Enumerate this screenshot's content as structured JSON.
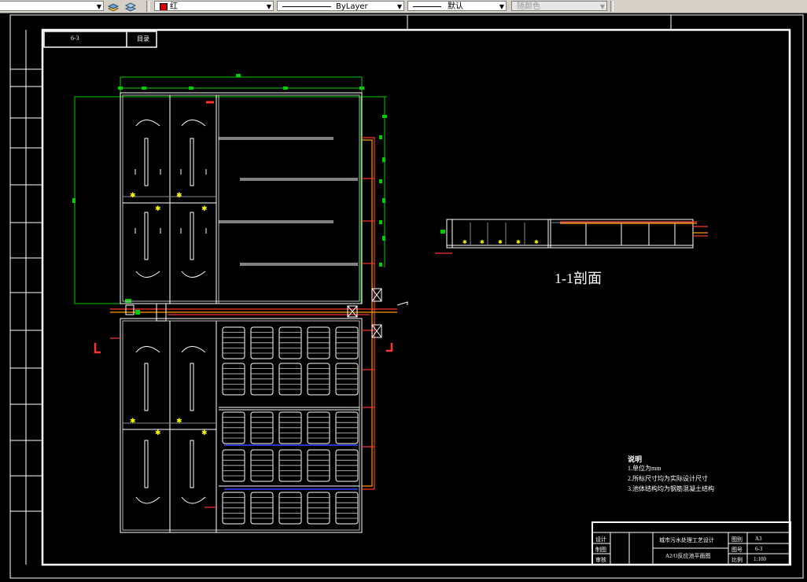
{
  "toolbar": {
    "layer_dropdown_value": "",
    "color_label": "红",
    "color_swatch": "#cc0000",
    "linetype_value": "ByLayer",
    "lineweight_value": "默认",
    "plotstyle_value": "随颜色"
  },
  "drawing": {
    "header_number": "6-3",
    "header_name": "目录",
    "section_title": "1-1剖面",
    "notes_title": "说明",
    "notes": [
      "1.单位为mm",
      "2.所标尺寸均为实际设计尺寸",
      "3.池体结构均为钢筋混凝土结构"
    ],
    "title_block": {
      "project": "城市污水处理工艺设计",
      "drawing_name": "A2/O反应池平面图",
      "row_labels": [
        "设计",
        "制图",
        "审核"
      ],
      "field_labels": [
        "图别",
        "图号",
        "比例"
      ],
      "field_values": [
        "A3",
        "6-3",
        "1:100"
      ]
    }
  },
  "colors": {
    "background": "#000000",
    "frame": "#ffffff",
    "pipe": "#ff3333",
    "pipe_orange": "#ff9900",
    "dimension": "#00cc00",
    "blue_line": "#3333ff"
  }
}
